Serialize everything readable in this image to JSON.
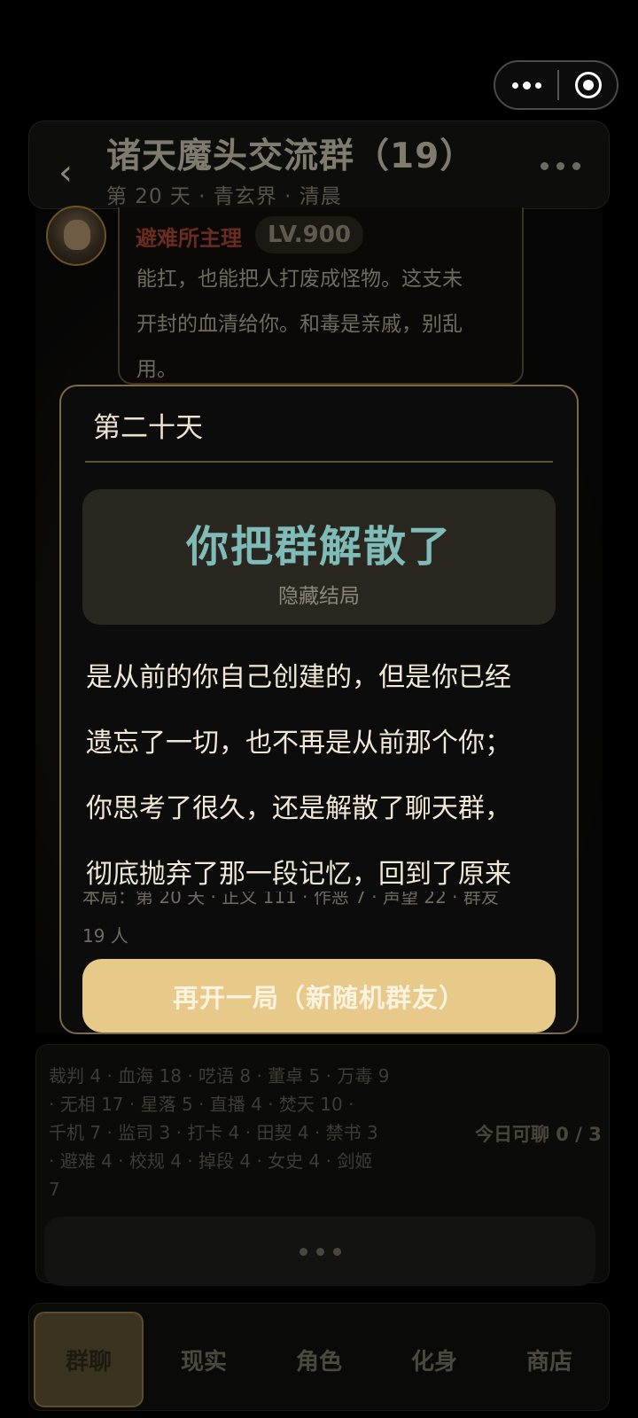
{
  "header": {
    "title": "诸天魔头交流群（19）",
    "subtitle": "第 20 天 · 青玄界 · 清晨"
  },
  "message": {
    "sender": "避难所主理",
    "level": "LV.900",
    "lines": [
      "能扛，也能把人打废成怪物。这支未",
      "开封的血清给你。和毒是亲戚，别乱",
      "用。"
    ]
  },
  "modal": {
    "day": "第二十天",
    "ending_title": "你把群解散了",
    "ending_type": "隐藏结局",
    "story_lines": [
      "是从前的你自己创建的，但是你已经",
      "遗忘了一切，也不再是从前那个你；",
      "你思考了很久，还是解散了聊天群，",
      "彻底抛弃了那一段记忆，回到了原来"
    ],
    "stats_line1": "本局：第 20 天 · 正义 111 · 作恶 7 · 声望 22 · 群友",
    "stats_line2": "19 人",
    "restart_label": "再开一局（新随机群友）"
  },
  "members": {
    "tags_lines": [
      "裁判 4 · 血海 18 · 呓语 8 · 董卓 5 · 万毒 9",
      "· 无相 17 · 星落 5 · 直播 4 · 焚天 10 ·",
      "千机 7 · 监司 3 · 打卡 4 · 田契 4 · 禁书 3",
      "· 避难 4 · 校规 4 · 掉段 4 · 女史 4 · 剑姬",
      "7"
    ],
    "today_chats": "今日可聊 0 / 3"
  },
  "tabs": [
    "群聊",
    "现实",
    "角色",
    "化身",
    "商店"
  ],
  "colors": {
    "accent": "#e7c98a",
    "ending_title": "#7fbcb8",
    "modal_border": "#7d6a43"
  }
}
